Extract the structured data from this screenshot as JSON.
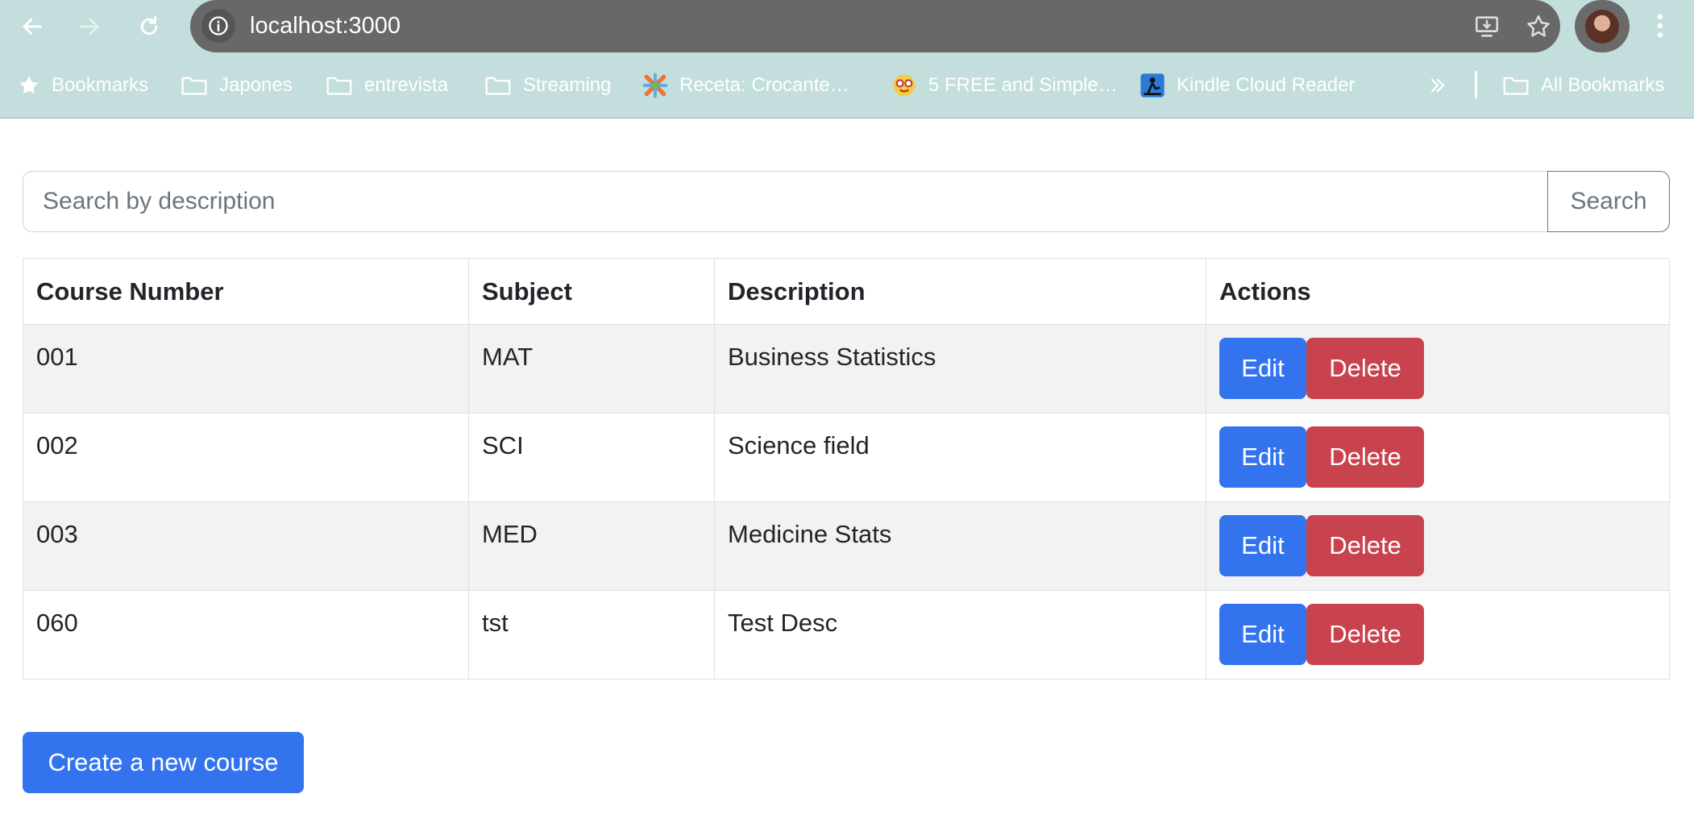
{
  "browser": {
    "url": "localhost:3000",
    "bookmarks": [
      {
        "label": "Bookmarks",
        "icon": "star-icon"
      },
      {
        "label": "Japones",
        "icon": "folder-icon"
      },
      {
        "label": "entrevista",
        "icon": "folder-icon"
      },
      {
        "label": "Streaming",
        "icon": "folder-icon"
      },
      {
        "label": "Receta: Crocante…",
        "icon": "site-favicon"
      },
      {
        "label": "5 FREE and Simple…",
        "icon": "nerd-emoji-icon"
      },
      {
        "label": "Kindle Cloud Reader",
        "icon": "kindle-icon"
      },
      {
        "label": "All Bookmarks",
        "icon": "folder-icon"
      }
    ]
  },
  "search": {
    "placeholder": "Search by description",
    "button_label": "Search"
  },
  "table": {
    "headers": [
      "Course Number",
      "Subject",
      "Description",
      "Actions"
    ],
    "rows": [
      {
        "course_number": "001",
        "subject": "MAT",
        "description": "Business Statistics"
      },
      {
        "course_number": "002",
        "subject": "SCI",
        "description": "Science field"
      },
      {
        "course_number": "003",
        "subject": "MED",
        "description": "Medicine Stats"
      },
      {
        "course_number": "060",
        "subject": "tst",
        "description": "Test Desc"
      }
    ],
    "edit_label": "Edit",
    "delete_label": "Delete"
  },
  "create_button_label": "Create a new course",
  "colors": {
    "chrome_bg": "#c3dedd",
    "primary": "#3374ee",
    "danger": "#c8434e"
  }
}
